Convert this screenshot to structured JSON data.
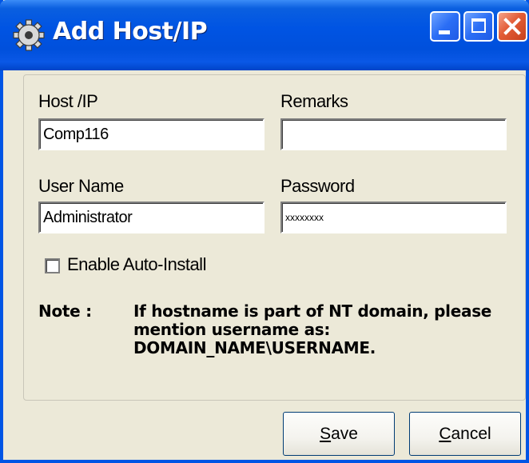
{
  "window": {
    "title": "Add Host/IP",
    "icon": "gear-icon",
    "controls": [
      "minimize-icon",
      "maximize-icon",
      "close-icon"
    ],
    "accent_color": "#0054e3",
    "close_color": "#e25c36",
    "background": "#ece9d8"
  },
  "form": {
    "host": {
      "label": "Host /IP",
      "value": "Comp116"
    },
    "remarks": {
      "label": "Remarks",
      "value": ""
    },
    "username": {
      "label": "User Name",
      "value": "Administrator"
    },
    "password": {
      "label": "Password",
      "value": "xxxxxxxx"
    },
    "auto_install": {
      "label": "Enable Auto-Install",
      "checked": false
    }
  },
  "note": {
    "label": "Note :",
    "line1": "If hostname is part of NT domain, please",
    "line2": "mention username as:",
    "line3": "DOMAIN_NAME\\USERNAME."
  },
  "buttons": {
    "save": {
      "first": "S",
      "rest": "ave"
    },
    "cancel": {
      "first": "C",
      "rest": "ancel"
    }
  }
}
